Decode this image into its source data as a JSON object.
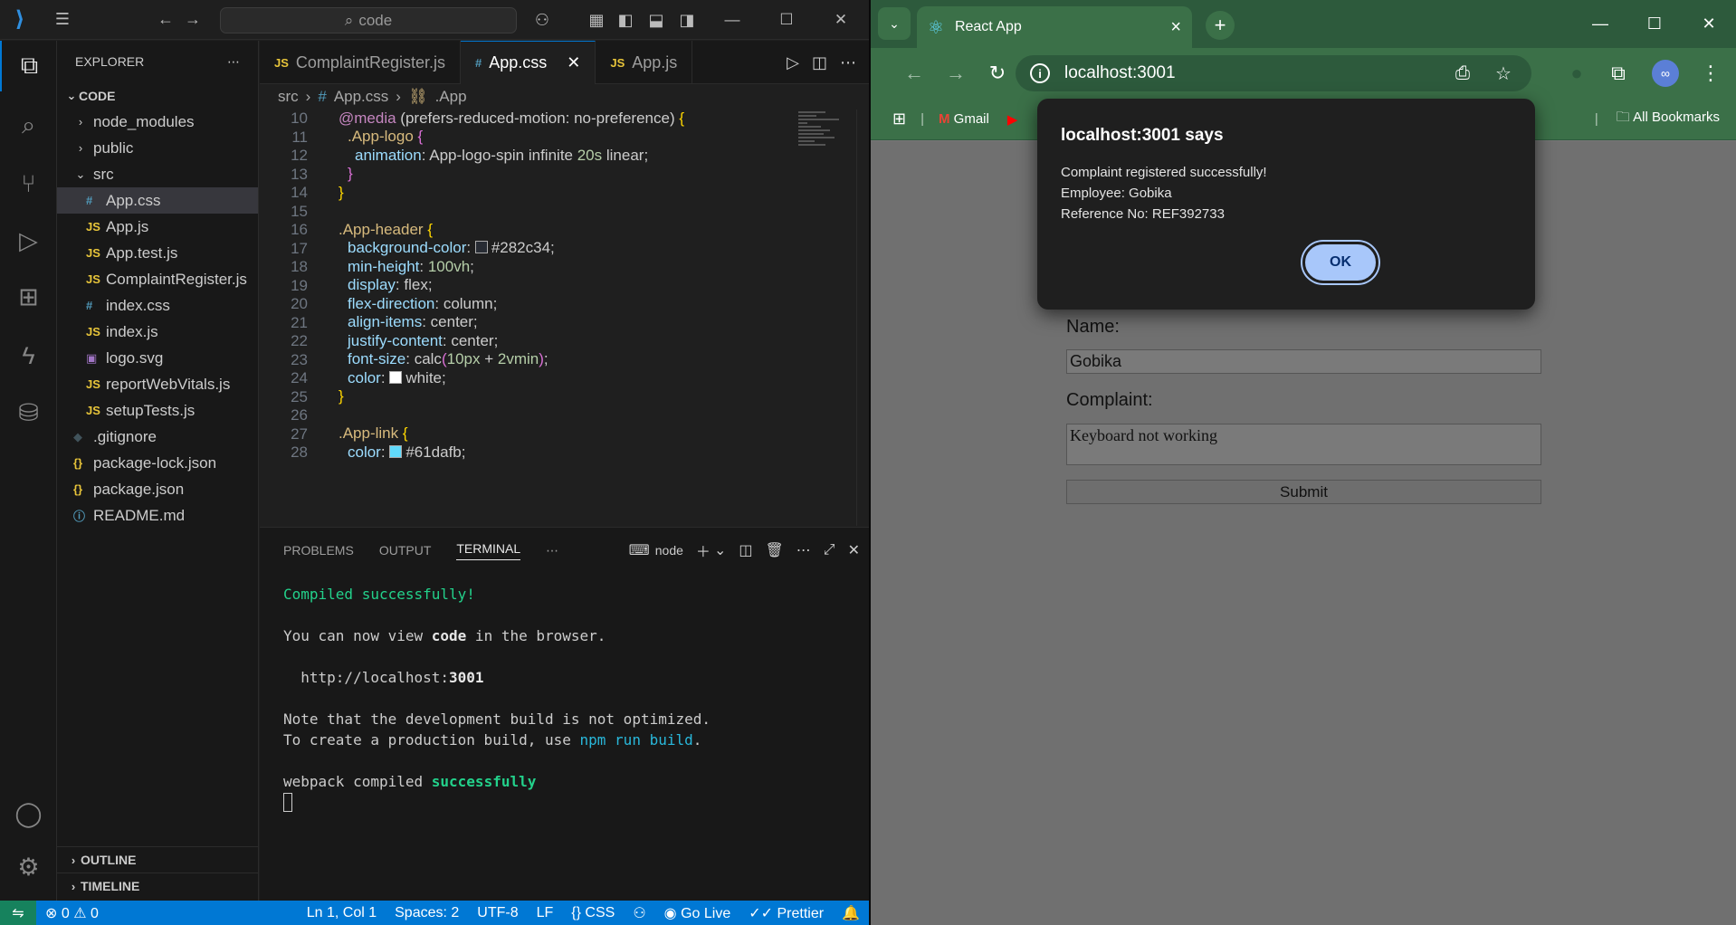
{
  "vscode": {
    "search_text": "code",
    "explorer": {
      "title": "EXPLORER",
      "root": "CODE",
      "items": [
        {
          "label": "node_modules",
          "type": "folder"
        },
        {
          "label": "public",
          "type": "folder"
        },
        {
          "label": "src",
          "type": "folder-open"
        },
        {
          "label": "App.css",
          "type": "css"
        },
        {
          "label": "App.js",
          "type": "js"
        },
        {
          "label": "App.test.js",
          "type": "js"
        },
        {
          "label": "ComplaintRegister.js",
          "type": "js"
        },
        {
          "label": "index.css",
          "type": "css"
        },
        {
          "label": "index.js",
          "type": "js"
        },
        {
          "label": "logo.svg",
          "type": "svg"
        },
        {
          "label": "reportWebVitals.js",
          "type": "js"
        },
        {
          "label": "setupTests.js",
          "type": "js"
        },
        {
          "label": ".gitignore",
          "type": "git"
        },
        {
          "label": "package-lock.json",
          "type": "json"
        },
        {
          "label": "package.json",
          "type": "json"
        },
        {
          "label": "README.md",
          "type": "info"
        }
      ],
      "outline": "OUTLINE",
      "timeline": "TIMELINE"
    },
    "tabs": [
      {
        "label": "ComplaintRegister.js",
        "icon": "JS"
      },
      {
        "label": "App.css",
        "icon": "#"
      },
      {
        "label": "App.js",
        "icon": "JS"
      }
    ],
    "breadcrumb": {
      "part1": "src",
      "part2": "App.css",
      "part3": ".App"
    },
    "line_numbers": [
      "10",
      "11",
      "12",
      "13",
      "14",
      "15",
      "16",
      "17",
      "18",
      "19",
      "20",
      "21",
      "22",
      "23",
      "24",
      "25",
      "26",
      "27",
      "28"
    ],
    "code": {
      "l10_at": "@media",
      "l10_rest": "(prefers-reduced-motion: no-preference)",
      "l10_brace": "{",
      "l11_sel": ".App-logo",
      "l11_brace": "{",
      "l12_prop": "animation",
      "l12_val1": "App-logo-spin infinite ",
      "l12_num": "20s",
      "l12_val2": " linear;",
      "l13_brace": "}",
      "l14_brace": "}",
      "l16_sel": ".App-header",
      "l16_brace": "{",
      "l17_prop": "background-color",
      "l17_val": "#282c34;",
      "l18_prop": "min-height",
      "l18_num": "100vh",
      "l18_end": ";",
      "l19_prop": "display",
      "l19_val": "flex;",
      "l20_prop": "flex-direction",
      "l20_val": "column;",
      "l21_prop": "align-items",
      "l21_val": "center;",
      "l22_prop": "justify-content",
      "l22_val": "center;",
      "l23_prop": "font-size",
      "l23_fn": "calc",
      "l23_num1": "10px",
      "l23_plus": " + ",
      "l23_num2": "2vmin",
      "l23_end": ";",
      "l24_prop": "color",
      "l24_val": "white;",
      "l25_brace": "}",
      "l27_sel": ".App-link",
      "l27_brace": "{",
      "l28_prop": "color",
      "l28_val": "#61dafb;"
    },
    "panel": {
      "tabs": [
        "PROBLEMS",
        "OUTPUT",
        "TERMINAL"
      ],
      "shell": "node",
      "terminal": {
        "line1": "Compiled successfully!",
        "line2a": "You can now view ",
        "line2b": "code",
        "line2c": " in the browser.",
        "line3a": "  http://localhost:",
        "line3b": "3001",
        "line4": "Note that the development build is not optimized.",
        "line5a": "To create a production build, use ",
        "line5b": "npm run build",
        "line5c": ".",
        "line6a": "webpack compiled ",
        "line6b": "successfully"
      }
    },
    "status": {
      "errors": "0",
      "warnings": "0",
      "position": "Ln 1, Col 1",
      "spaces": "Spaces: 2",
      "encoding": "UTF-8",
      "eol": "LF",
      "language": "CSS",
      "golive": "Go Live",
      "prettier": "Prettier"
    },
    "colors": {
      "accent": "#0078d4",
      "background": "#1f1f1f"
    }
  },
  "chrome": {
    "tab_title": "React App",
    "url": "localhost:3001",
    "bookmarks": {
      "gmail": "Gmail",
      "all": "All Bookmarks"
    },
    "form": {
      "name_label": "Name:",
      "name_value": "Gobika",
      "complaint_label": "Complaint:",
      "complaint_value": "Keyboard not working",
      "submit": "Submit"
    },
    "dialog": {
      "title": "localhost:3001 says",
      "line1": "Complaint registered successfully!",
      "line2": "Employee: Gobika",
      "line3": "Reference No: REF392733",
      "ok": "OK"
    },
    "colors": {
      "theme": "#3b7048",
      "dialog_button": "#a8c7fa"
    }
  }
}
